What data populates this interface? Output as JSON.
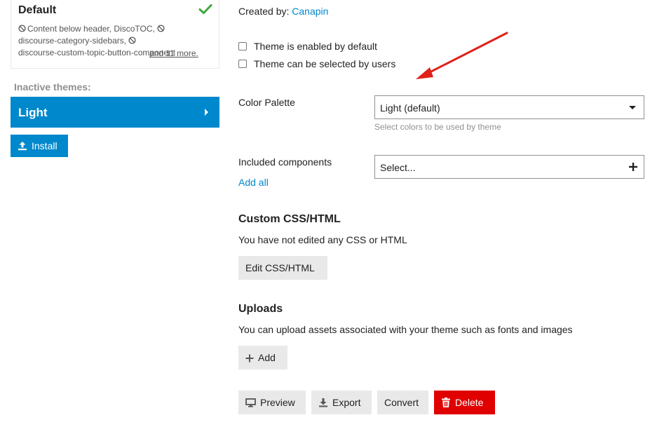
{
  "sidebar": {
    "active_theme": {
      "name": "Default",
      "components_text_parts": [
        "Content below header, DiscoTOC,",
        "discourse-category-sidebars,",
        "discourse-custom-topic-button-component"
      ],
      "more_link": "and 11 more.",
      "status_icon": "check-icon"
    },
    "inactive_label": "Inactive themes:",
    "inactive_themes": [
      {
        "name": "Light"
      }
    ],
    "install_label": "Install"
  },
  "main": {
    "created_by_label": "Created by:",
    "created_by_author": "Canapin",
    "checkboxes": [
      {
        "label": "Theme is enabled by default",
        "checked": false
      },
      {
        "label": "Theme can be selected by users",
        "checked": false
      }
    ],
    "color_palette": {
      "label": "Color Palette",
      "selected": "Light (default)",
      "help": "Select colors to be used by theme"
    },
    "included_components": {
      "label": "Included components",
      "placeholder": "Select...",
      "add_all": "Add all"
    },
    "custom_css": {
      "title": "Custom CSS/HTML",
      "description": "You have not edited any CSS or HTML",
      "button": "Edit CSS/HTML"
    },
    "uploads": {
      "title": "Uploads",
      "description": "You can upload assets associated with your theme such as fonts and images",
      "button": "Add"
    },
    "actions": {
      "preview": "Preview",
      "export": "Export",
      "convert": "Convert",
      "delete": "Delete"
    }
  },
  "colors": {
    "accent": "#0088cc",
    "danger": "#e00000",
    "success": "#3ea83e",
    "annotation_arrow": "#e0201b"
  }
}
